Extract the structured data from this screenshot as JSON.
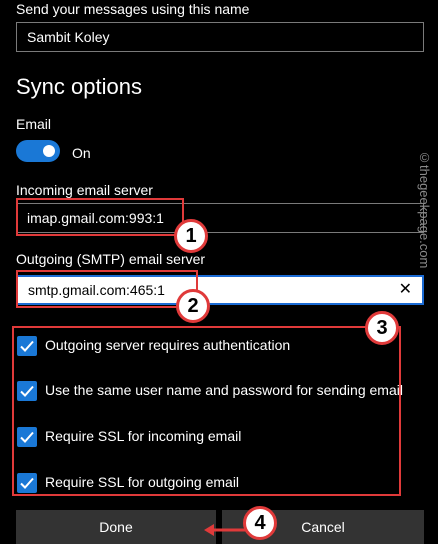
{
  "account_name": {
    "label": "Send your messages using this name",
    "value": "Sambit Koley"
  },
  "sync": {
    "heading": "Sync options",
    "email_label": "Email",
    "email_toggle_state": "On"
  },
  "incoming": {
    "label": "Incoming email server",
    "value": "imap.gmail.com:993:1"
  },
  "outgoing": {
    "label": "Outgoing (SMTP) email server",
    "value": "smtp.gmail.com:465:1",
    "clear_icon": "close-icon"
  },
  "options": [
    {
      "label": "Outgoing server requires authentication",
      "checked": true
    },
    {
      "label": "Use the same user name and password for sending email",
      "checked": true
    },
    {
      "label": "Require SSL for incoming email",
      "checked": true
    },
    {
      "label": "Require SSL for outgoing email",
      "checked": true
    }
  ],
  "buttons": {
    "done": "Done",
    "cancel": "Cancel"
  },
  "annotations": {
    "badge1": "1",
    "badge2": "2",
    "badge3": "3",
    "badge4": "4"
  },
  "watermark": "©thegeekpage.com",
  "colors": {
    "accent": "#1a78d6",
    "annotation": "#e03a3a",
    "button": "#333333"
  }
}
